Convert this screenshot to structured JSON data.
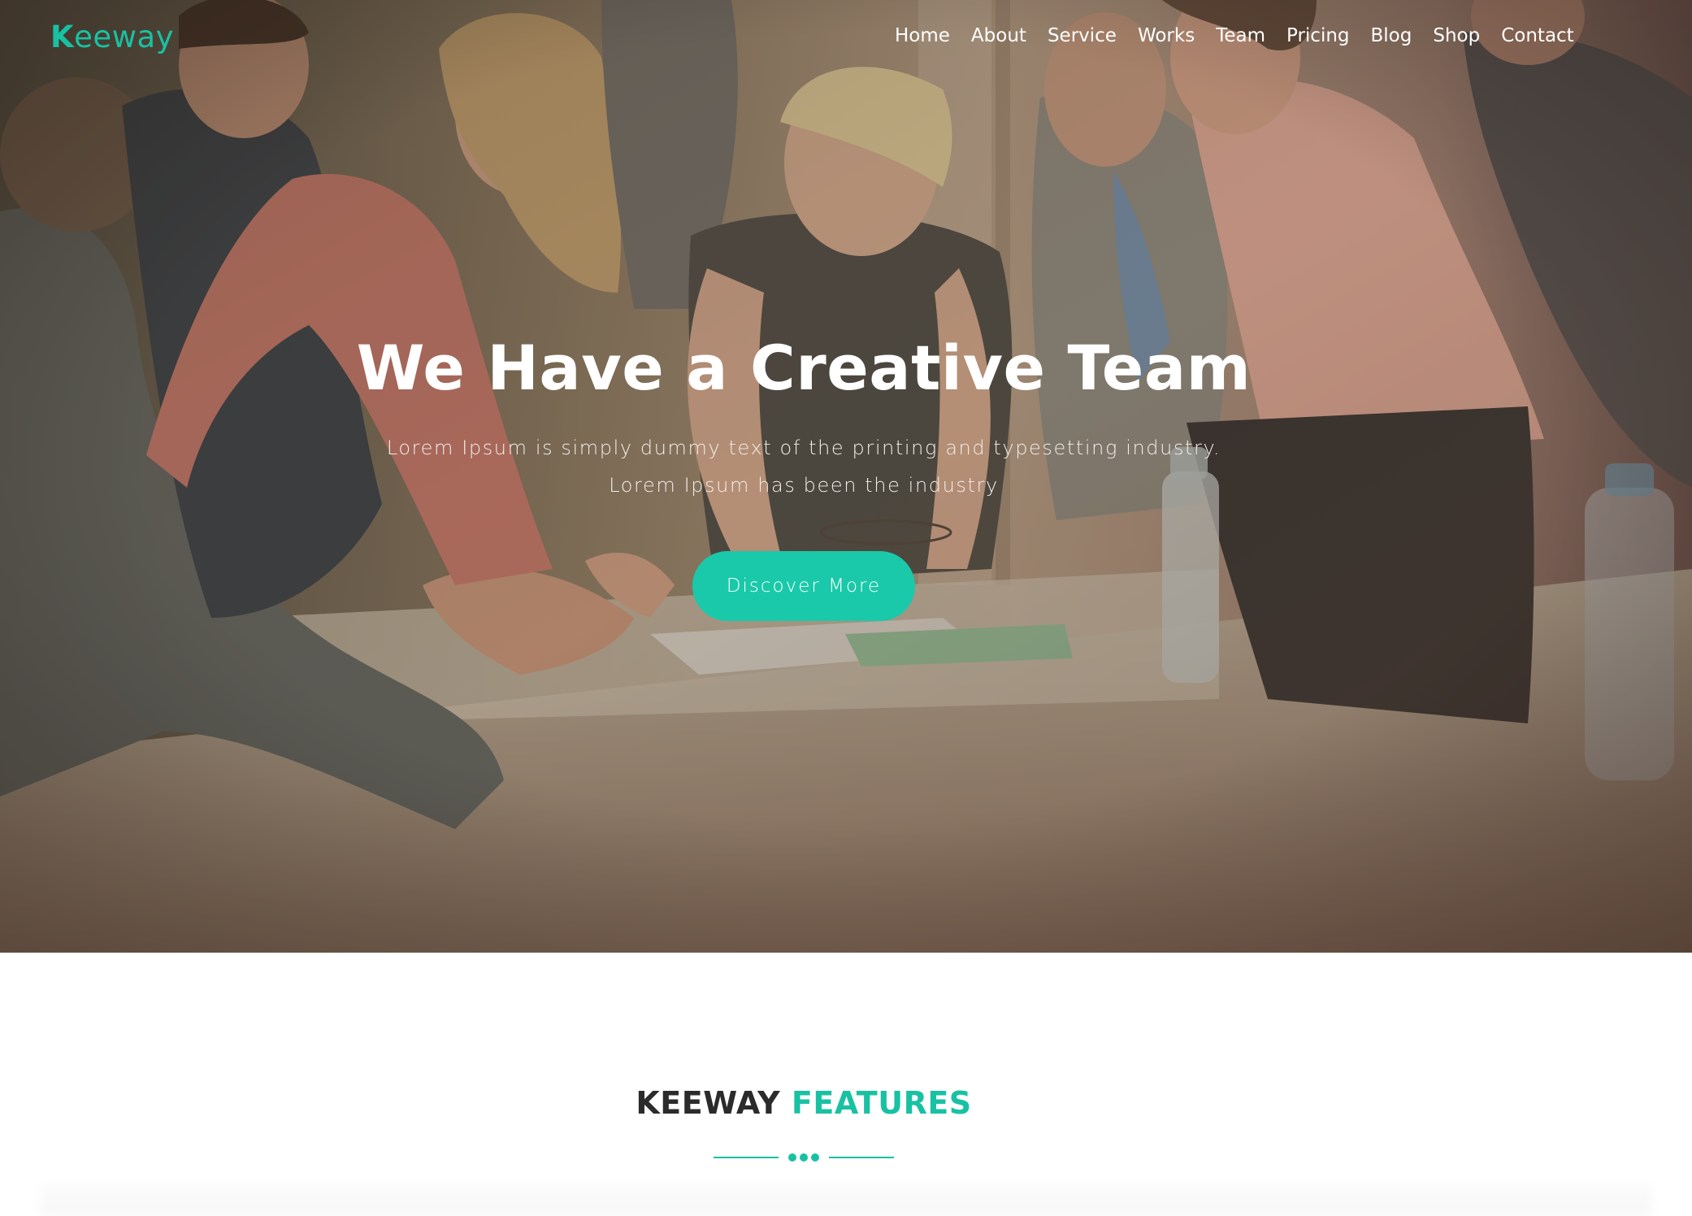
{
  "brand": {
    "logo_initial": "K",
    "logo_rest": "eeway",
    "accent_color": "#19c1a3"
  },
  "nav": {
    "items": [
      {
        "label": "Home"
      },
      {
        "label": "About"
      },
      {
        "label": "Service"
      },
      {
        "label": "Works"
      },
      {
        "label": "Team"
      },
      {
        "label": "Pricing"
      },
      {
        "label": "Blog"
      },
      {
        "label": "Shop"
      },
      {
        "label": "Contact"
      }
    ]
  },
  "hero": {
    "title": "We Have a Creative Team",
    "subtitle_line1": "Lorem Ipsum is simply dummy text of the printing and typesetting industry.",
    "subtitle_line2": "Lorem Ipsum has been the industry",
    "cta_label": "Discover More",
    "cta_color": "#1ac9a9"
  },
  "features": {
    "title_part1": "KEEWAY",
    "title_part2": "FEATURES"
  }
}
